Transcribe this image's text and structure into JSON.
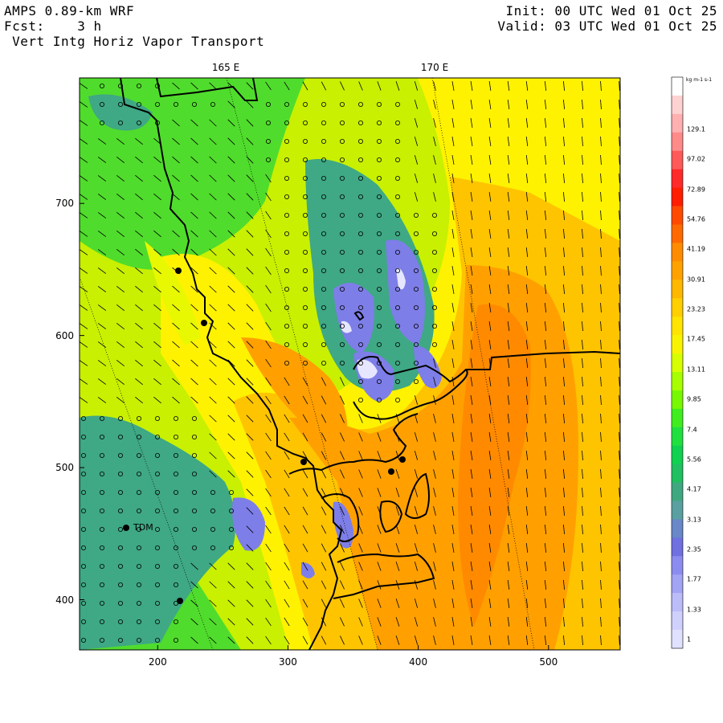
{
  "header": {
    "model": "AMPS 0.89-km WRF",
    "forecast_label": "Fcst:",
    "forecast_hours": "3 h",
    "field": "Vert Intg Horiz Vapor Transport",
    "init": "Init: 00 UTC Wed 01 Oct 25",
    "valid": "Valid: 03 UTC Wed 01 Oct 25"
  },
  "longitude_labels": [
    "165 E",
    "170 E"
  ],
  "axes": {
    "x_ticks": [
      "200",
      "300",
      "400",
      "500"
    ],
    "y_ticks": [
      "700",
      "600",
      "500",
      "400"
    ],
    "x_range": [
      140,
      555
    ],
    "y_range": [
      362,
      795
    ]
  },
  "station": {
    "label": "TDM"
  },
  "colorbar": {
    "unit": "kg m-1 s-1",
    "labels": [
      "129.1",
      "97.02",
      "72.89",
      "54.76",
      "41.19",
      "30.91",
      "23.23",
      "17.45",
      "13.11",
      "9.85",
      "7.4",
      "5.56",
      "4.17",
      "3.13",
      "2.35",
      "1.77",
      "1.33",
      "1"
    ],
    "colors": [
      "#ffffff",
      "#ffd2d2",
      "#ffb0b0",
      "#ff8a8a",
      "#ff5a5a",
      "#ff2a2a",
      "#ff1e00",
      "#ff4a00",
      "#ff6a00",
      "#ff8c00",
      "#ffa200",
      "#ffb800",
      "#ffcf00",
      "#ffe400",
      "#f8f400",
      "#d8ff00",
      "#a8ff00",
      "#78f800",
      "#40ee20",
      "#20e040",
      "#10d050",
      "#20c060",
      "#40a880",
      "#5aa0a0",
      "#6888c8",
      "#7070e0",
      "#8c8cf0",
      "#a4a4f4",
      "#bcbcf8",
      "#d0d0fc",
      "#e0e0ff"
    ]
  },
  "map_colors": {
    "background": "#50dc2c",
    "yellow_green": "#c8f000",
    "yellow": "#fff200",
    "gold": "#ffc400",
    "orange": "#ffa000",
    "dark_orange": "#ff8a00",
    "teal": "#3fa884",
    "blue": "#7e7ee8",
    "lavender": "#e6e6ff"
  }
}
